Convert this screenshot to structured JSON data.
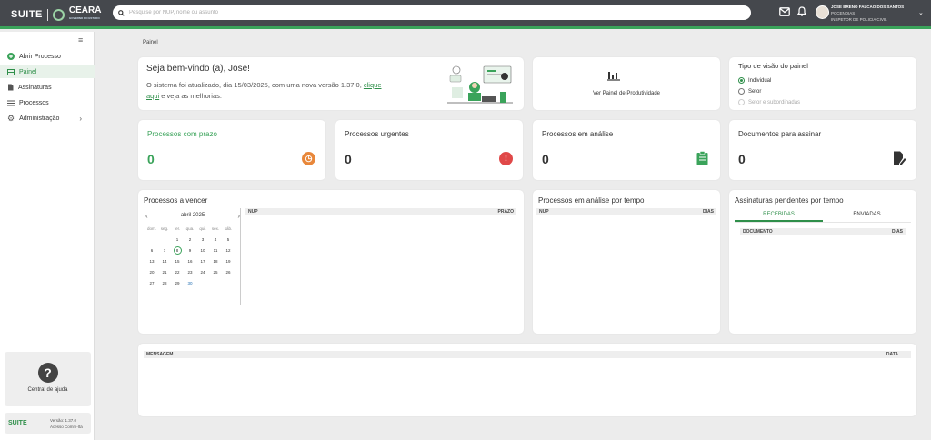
{
  "brand": {
    "suite": "SUITE",
    "ceara": "CEARÁ",
    "ceara_sub": "GOVERNO DO ESTADO"
  },
  "search": {
    "placeholder": "Pesquise por NUP, nome ou assunto",
    "value": ""
  },
  "user": {
    "name": "JOSE BRENO FALCAO DOS SANTOS",
    "org": "PCCENDIAS",
    "role": "INSPETOR DE POLICIA CIVIL"
  },
  "sidebar": {
    "items": [
      {
        "label": "Abrir Processo",
        "icon": "plus-circle-icon"
      },
      {
        "label": "Painel",
        "icon": "dashboard-icon"
      },
      {
        "label": "Assinaturas",
        "icon": "signature-icon"
      },
      {
        "label": "Processos",
        "icon": "list-icon"
      },
      {
        "label": "Administração",
        "icon": "gear-icon"
      }
    ],
    "help_label": "Central de ajuda",
    "version_brand": "SUITE",
    "version_line1": "Versão: 1.37.0",
    "version_line2": "Acesso Comm-Ita"
  },
  "breadcrumb": "Painel",
  "welcome": {
    "title": "Seja bem-vindo (a), Jose!",
    "text_before": "O sistema foi atualizado, dia 15/03/2025, com uma nova versão 1.37.0, ",
    "link": "clique aqui",
    "text_after": " e veja as melhorias."
  },
  "productivity_label": "Ver Painel de Produtividade",
  "view_type": {
    "title": "Tipo de visão do painel",
    "options": [
      "Individual",
      "Setor",
      "Setor e subordinadas"
    ],
    "selected": "Individual"
  },
  "stats": [
    {
      "title": "Processos com prazo",
      "value": "0",
      "icon": "clock-icon"
    },
    {
      "title": "Processos urgentes",
      "value": "0",
      "icon": "exclamation-icon"
    },
    {
      "title": "Processos em análise",
      "value": "0",
      "icon": "clipboard-icon"
    },
    {
      "title": "Documentos para assinar",
      "value": "0",
      "icon": "sign-document-icon"
    }
  ],
  "due": {
    "title": "Processos a vencer",
    "month": "abril 2025",
    "weekdays": [
      "dom.",
      "seg.",
      "ter.",
      "qua.",
      "qui.",
      "sex.",
      "sáb."
    ],
    "days": [
      1,
      2,
      3,
      4,
      5,
      6,
      7,
      8,
      9,
      10,
      11,
      12,
      13,
      14,
      15,
      16,
      17,
      18,
      19,
      20,
      21,
      22,
      23,
      24,
      25,
      26,
      27,
      28,
      29,
      30
    ],
    "today": 8,
    "col_nup": "NUP",
    "col_prazo": "PRAZO"
  },
  "analysis": {
    "title": "Processos em análise por tempo",
    "col_nup": "NUP",
    "col_dias": "DIAS"
  },
  "pending": {
    "title": "Assinaturas pendentes por tempo",
    "tab_received": "RECEBIDAS",
    "tab_sent": "ENVIADAS",
    "col_doc": "DOCUMENTO",
    "col_dias": "DIAS"
  },
  "messages": {
    "col_msg": "MENSAGEM",
    "col_data": "DATA"
  },
  "colors": {
    "accent": "#3aa35a",
    "topbar": "#45484d",
    "warning": "#e8873a",
    "danger": "#e04848"
  }
}
